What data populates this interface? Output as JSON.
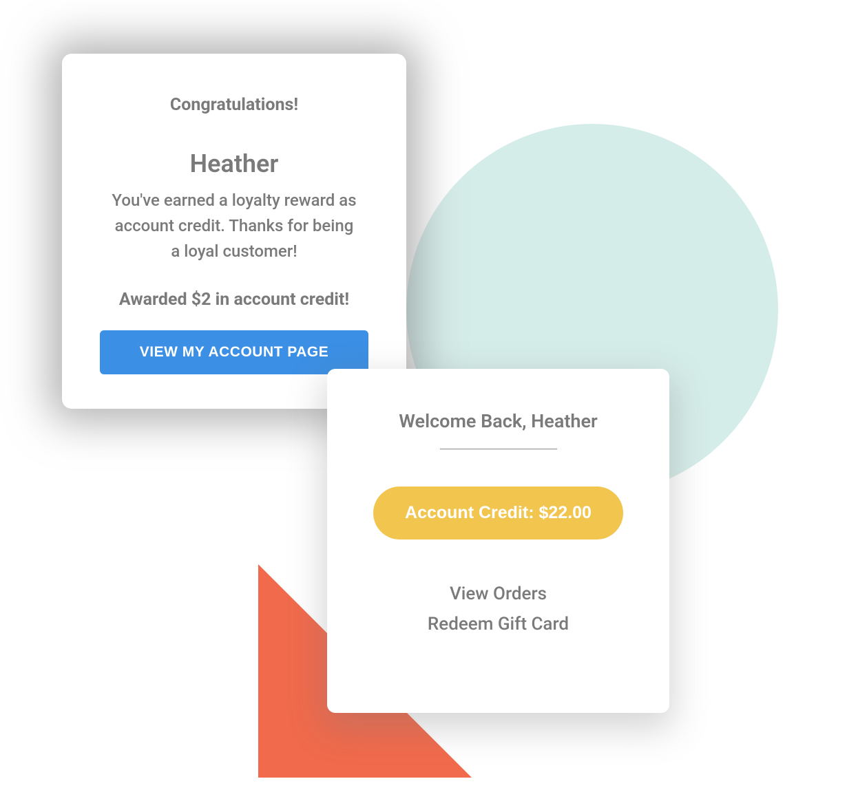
{
  "reward_card": {
    "heading": "Congratulations!",
    "user_name": "Heather",
    "message": "You've earned a loyalty reward as account credit. Thanks for being a loyal customer!",
    "awarded_text": "Awarded $2 in account credit!",
    "button_label": "VIEW MY ACCOUNT PAGE"
  },
  "account_card": {
    "welcome_text": "Welcome Back, Heather",
    "credit_label": "Account Credit: $22.00",
    "links": {
      "view_orders": "View Orders",
      "redeem_gift_card": "Redeem Gift Card"
    }
  },
  "colors": {
    "circle": "#d5ede9",
    "triangle": "#f16a4c",
    "primary_button": "#3b8fe4",
    "pill": "#f1c54e",
    "text_muted": "#7a7a7a"
  }
}
